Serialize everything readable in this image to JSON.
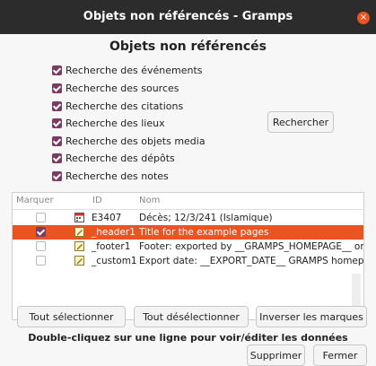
{
  "window": {
    "title": "Objets non référencés - Gramps",
    "close_glyph": "×"
  },
  "heading": "Objets non référencés",
  "options": [
    {
      "label": "Recherche des événements",
      "checked": true
    },
    {
      "label": "Recherche des sources",
      "checked": true
    },
    {
      "label": "Recherche des citations",
      "checked": true
    },
    {
      "label": "Recherche des lieux",
      "checked": true
    },
    {
      "label": "Recherche des objets media",
      "checked": true
    },
    {
      "label": "Recherche des dépôts",
      "checked": true
    },
    {
      "label": "Recherche des notes",
      "checked": true
    }
  ],
  "search_button": "Rechercher",
  "table": {
    "columns": [
      "Marquer",
      "ID",
      "Nom"
    ],
    "rows": [
      {
        "checked": false,
        "icon": "event-icon",
        "id": "E3407",
        "name": "Décès; 12/3/241 (Islamique)",
        "selected": false
      },
      {
        "checked": true,
        "icon": "note-icon",
        "id": "_header1",
        "name": "Title for the example pages",
        "selected": true
      },
      {
        "checked": false,
        "icon": "note-icon",
        "id": "_footer1",
        "name": "Footer: exported by __GRAMPS_HOMEPAGE__ on __EX",
        "selected": false
      },
      {
        "checked": false,
        "icon": "note-icon",
        "id": "_custom1",
        "name": "Export date: __EXPORT_DATE__ GRAMPS homepage: _",
        "selected": false
      }
    ]
  },
  "buttons": {
    "select_all": "Tout sélectionner",
    "deselect_all": "Tout désélectionner",
    "invert": "Inverser les marques"
  },
  "info": "Double-cliquez sur une ligne pour voir/éditer les données",
  "actions": {
    "delete": "Supprimer",
    "close": "Fermer"
  },
  "colors": {
    "accent": "#e95420",
    "checkbox": "#7a3c63",
    "titlebar": "#2c2c2c"
  }
}
